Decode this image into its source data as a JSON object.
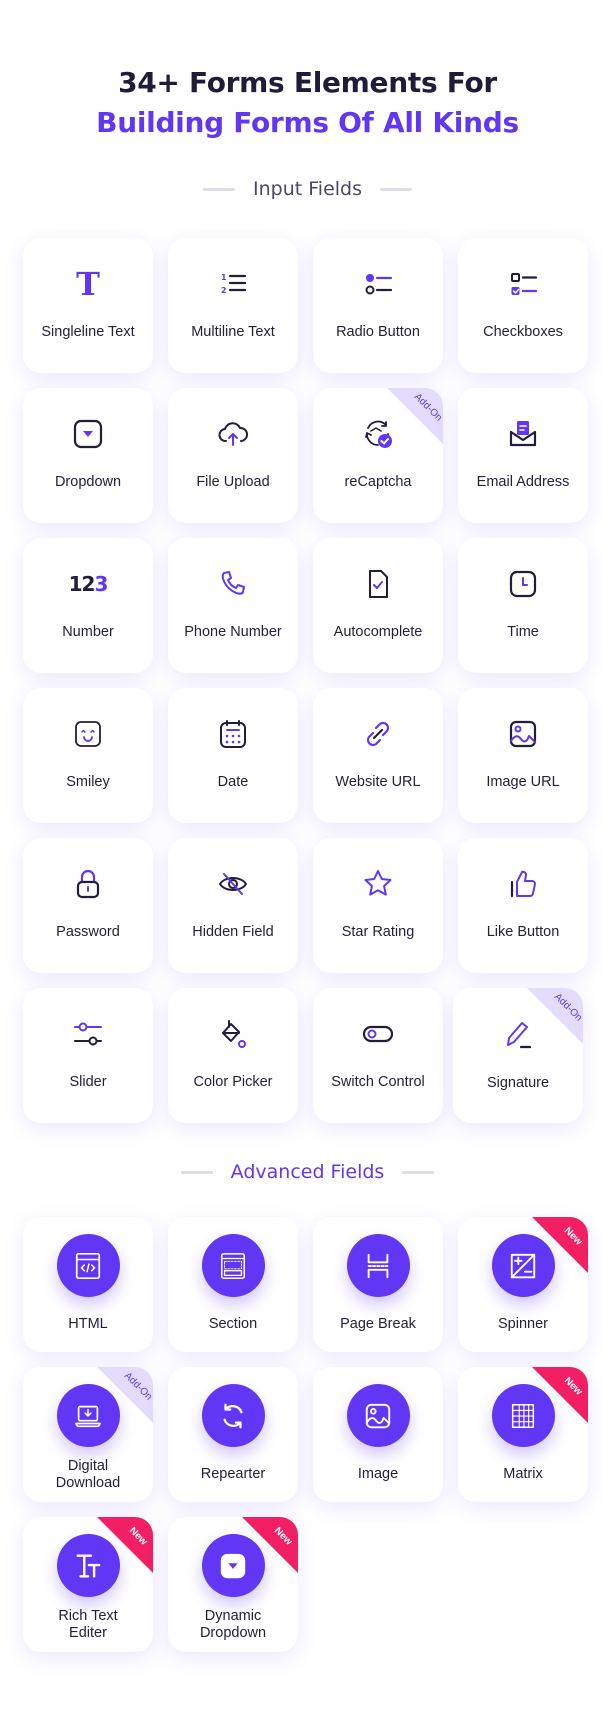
{
  "header": {
    "title_line1": "34+ Forms Elements For",
    "title_line2": "Building Forms Of All Kinds"
  },
  "colors": {
    "accent": "#6236f5",
    "dark": "#1f1b38",
    "addon_badge": "#e4dcff",
    "new_badge": "#f21f64"
  },
  "sections": {
    "input": {
      "title": "Input Fields",
      "items": [
        {
          "label": "Singleline Text",
          "icon": "text-t-icon"
        },
        {
          "label": "Multiline Text",
          "icon": "numbered-list-icon"
        },
        {
          "label": "Radio Button",
          "icon": "radio-list-icon"
        },
        {
          "label": "Checkboxes",
          "icon": "checkbox-list-icon"
        },
        {
          "label": "Dropdown",
          "icon": "dropdown-icon"
        },
        {
          "label": "File Upload",
          "icon": "cloud-upload-icon"
        },
        {
          "label": "reCaptcha",
          "icon": "recaptcha-icon",
          "badge": "Add-On"
        },
        {
          "label": "Email Address",
          "icon": "email-icon"
        },
        {
          "label": "Number",
          "icon": "number-icon",
          "icon_text": [
            "12",
            "3"
          ]
        },
        {
          "label": "Phone Number",
          "icon": "phone-icon"
        },
        {
          "label": "Autocomplete",
          "icon": "autocomplete-icon"
        },
        {
          "label": "Time",
          "icon": "clock-icon"
        },
        {
          "label": "Smiley",
          "icon": "smiley-icon"
        },
        {
          "label": "Date",
          "icon": "calendar-icon"
        },
        {
          "label": "Website URL",
          "icon": "link-icon"
        },
        {
          "label": "Image URL",
          "icon": "image-icon"
        },
        {
          "label": "Password",
          "icon": "lock-icon"
        },
        {
          "label": "Hidden Field",
          "icon": "eye-off-icon"
        },
        {
          "label": "Star Rating",
          "icon": "star-icon"
        },
        {
          "label": "Like Button",
          "icon": "thumbs-up-icon"
        },
        {
          "label": "Slider",
          "icon": "slider-icon"
        },
        {
          "label": "Color Picker",
          "icon": "paint-bucket-icon"
        },
        {
          "label": "Switch Control",
          "icon": "toggle-icon"
        },
        {
          "label": "Signature",
          "icon": "pen-icon",
          "badge": "Add-On"
        }
      ]
    },
    "advanced": {
      "title": "Advanced Fields",
      "items": [
        {
          "label": "HTML",
          "icon": "code-window-icon"
        },
        {
          "label": "Section",
          "icon": "section-layout-icon"
        },
        {
          "label": "Page Break",
          "icon": "page-break-icon"
        },
        {
          "label": "Spinner",
          "icon": "plus-minus-icon",
          "badge": "New"
        },
        {
          "label_lines": [
            "Digital",
            "Download"
          ],
          "icon": "laptop-download-icon",
          "badge": "Add-On"
        },
        {
          "label": "Repearter",
          "icon": "refresh-icon"
        },
        {
          "label": "Image",
          "icon": "image-icon"
        },
        {
          "label": "Matrix",
          "icon": "grid-table-icon",
          "badge": "New"
        },
        {
          "label_lines": [
            "Rich Text",
            "Editer"
          ],
          "icon": "rich-text-icon",
          "badge": "New"
        },
        {
          "label_lines": [
            "Dynamic",
            "Dropdown"
          ],
          "icon": "dropdown-icon",
          "badge": "New"
        }
      ]
    }
  }
}
